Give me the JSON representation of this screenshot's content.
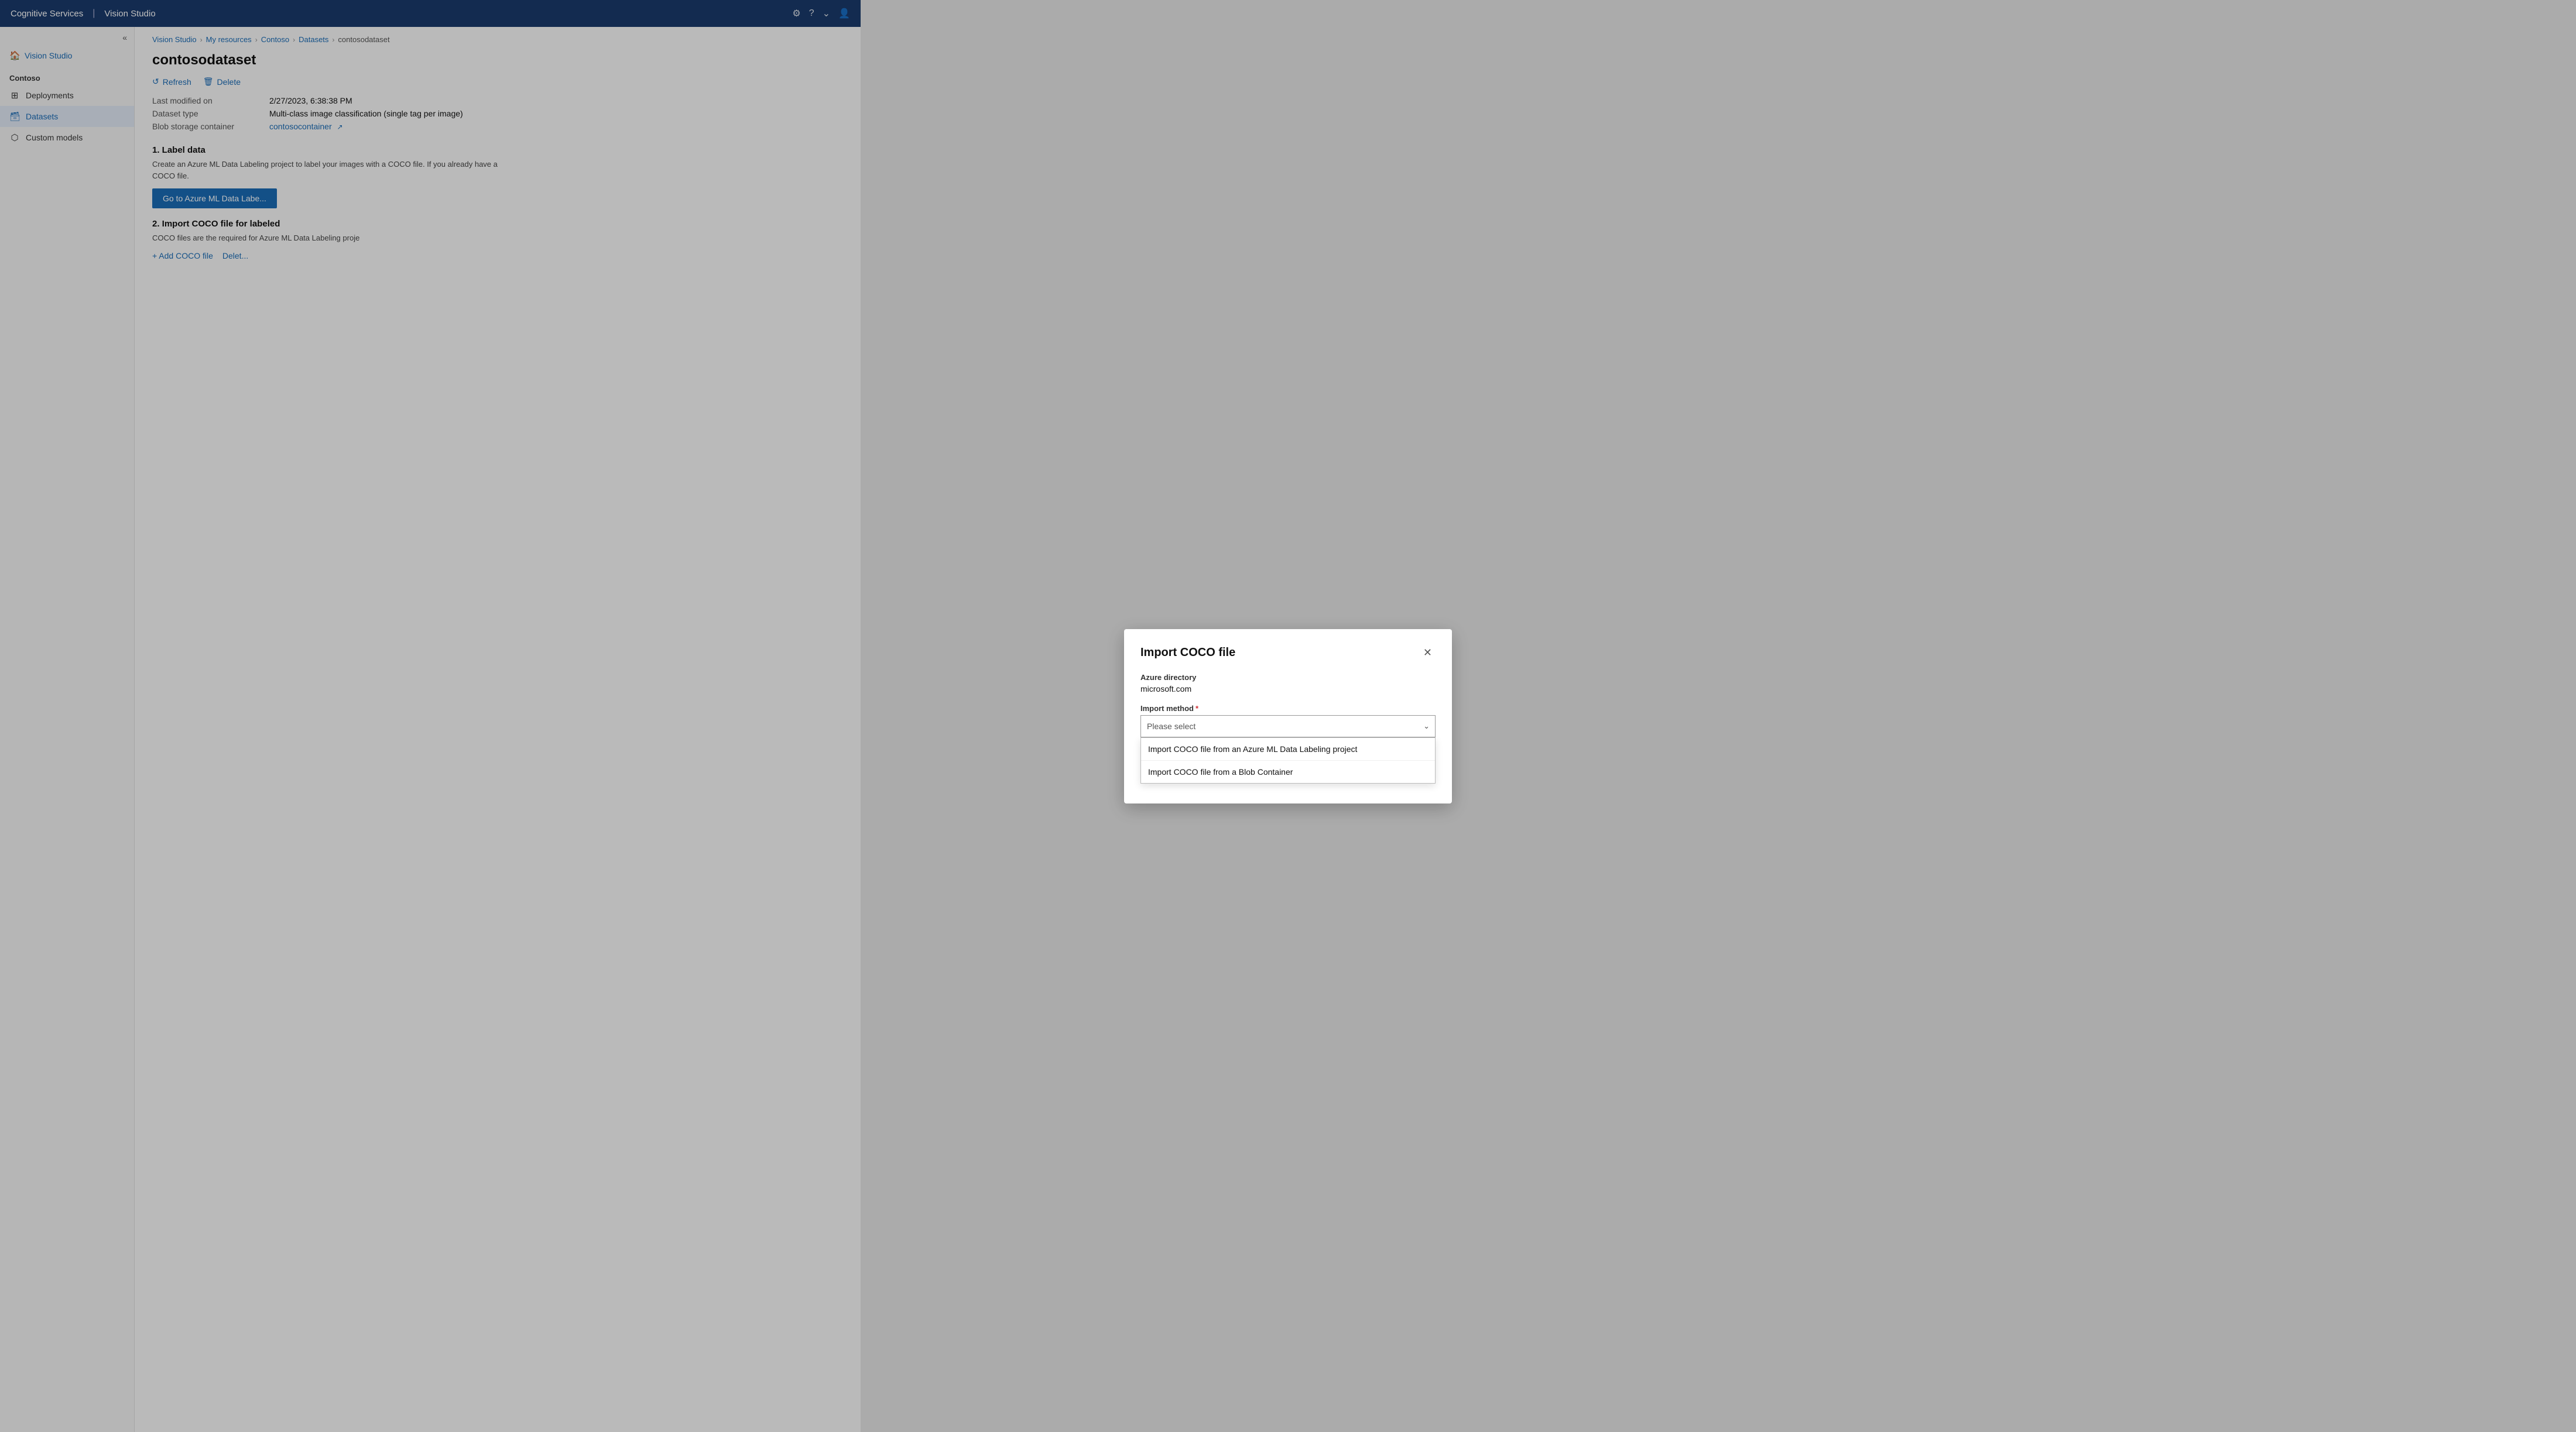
{
  "topbar": {
    "app_name": "Cognitive Services",
    "separator": "|",
    "subtitle": "Vision Studio",
    "icons": {
      "settings": "⚙",
      "help": "?",
      "chevron": "⌄",
      "user": "👤"
    }
  },
  "sidebar": {
    "collapse_icon": "«",
    "studio_link": "Vision Studio",
    "section_label": "Contoso",
    "items": [
      {
        "id": "deployments",
        "label": "Deployments",
        "icon": "⊞"
      },
      {
        "id": "datasets",
        "label": "Datasets",
        "icon": "🗃"
      },
      {
        "id": "custom-models",
        "label": "Custom models",
        "icon": "⬡"
      }
    ]
  },
  "breadcrumb": {
    "items": [
      {
        "id": "vision-studio",
        "label": "Vision Studio"
      },
      {
        "id": "my-resources",
        "label": "My resources"
      },
      {
        "id": "contoso",
        "label": "Contoso"
      },
      {
        "id": "datasets",
        "label": "Datasets"
      },
      {
        "id": "contosodataset",
        "label": "contosodataset"
      }
    ]
  },
  "page": {
    "title": "contosodataset",
    "toolbar": {
      "refresh_label": "Refresh",
      "refresh_icon": "↺",
      "delete_label": "Delete",
      "delete_icon": "🗑"
    },
    "info": {
      "last_modified_label": "Last modified on",
      "last_modified_value": "2/27/2023, 6:38:38 PM",
      "dataset_type_label": "Dataset type",
      "dataset_type_value": "Multi-class image classification (single tag per image)",
      "blob_storage_label": "Blob storage container",
      "blob_storage_link": "contosocontainer",
      "blob_storage_ext_icon": "↗"
    },
    "step1": {
      "title": "1. Label data",
      "description": "Create an Azure ML Data Labeling project to label your images with a COCO file. If you already have a COCO",
      "description_suffix": "file.",
      "btn_label": "Go to Azure ML Data Labe..."
    },
    "step2": {
      "title": "2. Import COCO file for labeled",
      "description": "COCO files are the required for Azure ML Data Labeling proje",
      "add_label": "+ Add COCO file",
      "delete_label": "Delet..."
    }
  },
  "modal": {
    "title": "Import COCO file",
    "close_icon": "✕",
    "azure_directory_label": "Azure directory",
    "azure_directory_value": "microsoft.com",
    "import_method_label": "Import method",
    "required_marker": "*",
    "select_placeholder": "Please select",
    "dropdown_options": [
      {
        "id": "azure-ml",
        "label": "Import COCO file from an Azure ML Data Labeling project"
      },
      {
        "id": "blob",
        "label": "Import COCO file from a Blob Container"
      }
    ]
  }
}
